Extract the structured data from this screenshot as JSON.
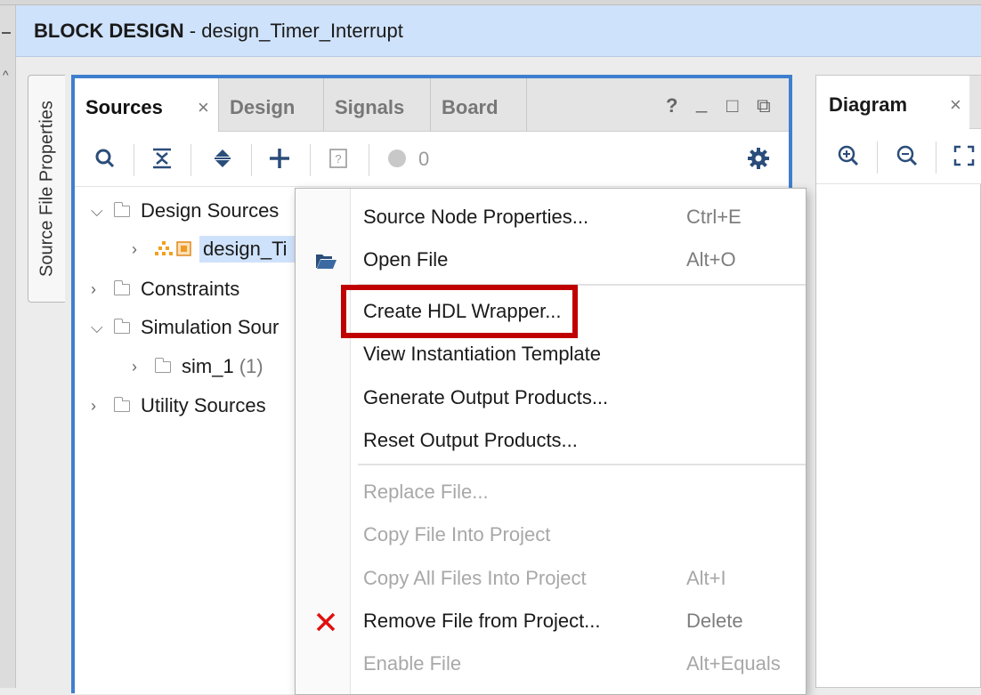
{
  "header": {
    "title": "BLOCK DESIGN",
    "separator": " - ",
    "design_name": "design_Timer_Interrupt"
  },
  "side_tab": {
    "label": "Source File Properties"
  },
  "sources_panel": {
    "tabs": [
      {
        "label": "Sources",
        "active": true,
        "closable": true
      },
      {
        "label": "Design",
        "active": false
      },
      {
        "label": "Signals",
        "active": false
      },
      {
        "label": "Board",
        "active": false
      }
    ],
    "close_glyph": "×",
    "window_controls": [
      "?",
      "_",
      "□",
      "⧉"
    ],
    "toolbar": {
      "icons": [
        "search-icon",
        "collapse-all-icon",
        "expand-all-icon",
        "add-sources-icon",
        "unknown-status-icon",
        "status-dot-icon",
        "settings-gear-icon"
      ],
      "status_count": "0"
    },
    "tree": [
      {
        "label": "Design Sources",
        "expanded": true
      },
      {
        "label": "design_Ti",
        "selected": true
      },
      {
        "label": "Constraints",
        "expanded": false
      },
      {
        "label": "Simulation Sour",
        "expanded": true
      },
      {
        "label": "sim_1",
        "count": "(1)"
      },
      {
        "label": "Utility Sources",
        "expanded": false
      }
    ]
  },
  "diagram_panel": {
    "tab_label": "Diagram",
    "close_glyph": "×",
    "toolbar_icons": [
      "zoom-in-icon",
      "zoom-out-icon",
      "fit-view-icon"
    ]
  },
  "context_menu": {
    "items": [
      {
        "label": "Source Node Properties...",
        "shortcut": "Ctrl+E",
        "enabled": true
      },
      {
        "label": "Open File",
        "shortcut": "Alt+O",
        "enabled": true,
        "icon": "folder-open-icon"
      },
      {
        "label": "Create HDL Wrapper...",
        "shortcut": "",
        "enabled": true,
        "highlighted": true
      },
      {
        "label": "View Instantiation Template",
        "shortcut": "",
        "enabled": true
      },
      {
        "label": "Generate Output Products...",
        "shortcut": "",
        "enabled": true
      },
      {
        "label": "Reset Output Products...",
        "shortcut": "",
        "enabled": true
      },
      {
        "label": "Replace File...",
        "shortcut": "",
        "enabled": false
      },
      {
        "label": "Copy File Into Project",
        "shortcut": "",
        "enabled": false
      },
      {
        "label": "Copy All Files Into Project",
        "shortcut": "Alt+I",
        "enabled": false
      },
      {
        "label": "Remove File from Project...",
        "shortcut": "Delete",
        "enabled": true,
        "icon": "remove-red-x-icon"
      },
      {
        "label": "Enable File",
        "shortcut": "Alt+Equals",
        "enabled": false
      }
    ]
  },
  "colors": {
    "header_bg": "#cfe2fb",
    "panel_focus_border": "#3f7fcf",
    "highlight_box": "#c00000",
    "icon_blue": "#2a4d7a",
    "remove_red": "#e01010"
  }
}
